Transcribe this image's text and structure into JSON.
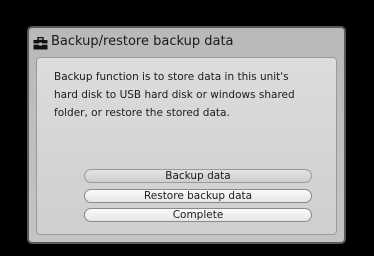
{
  "dialog": {
    "title": "Backup/restore backup data",
    "title_icon": "toolbox-icon",
    "message": "Backup function is to store data in this unit's\nhard disk to USB hard disk or windows shared\nfolder, or restore the stored data.",
    "buttons": [
      {
        "label": "Backup data",
        "selected": true
      },
      {
        "label": "Restore backup data",
        "selected": false
      },
      {
        "label": "Complete",
        "selected": false
      }
    ]
  },
  "colors": {
    "background": "#000000",
    "dialog_frame": "#b9b9b9",
    "content_panel": "#d6d6d6",
    "button_face": "#f0f0f0"
  }
}
